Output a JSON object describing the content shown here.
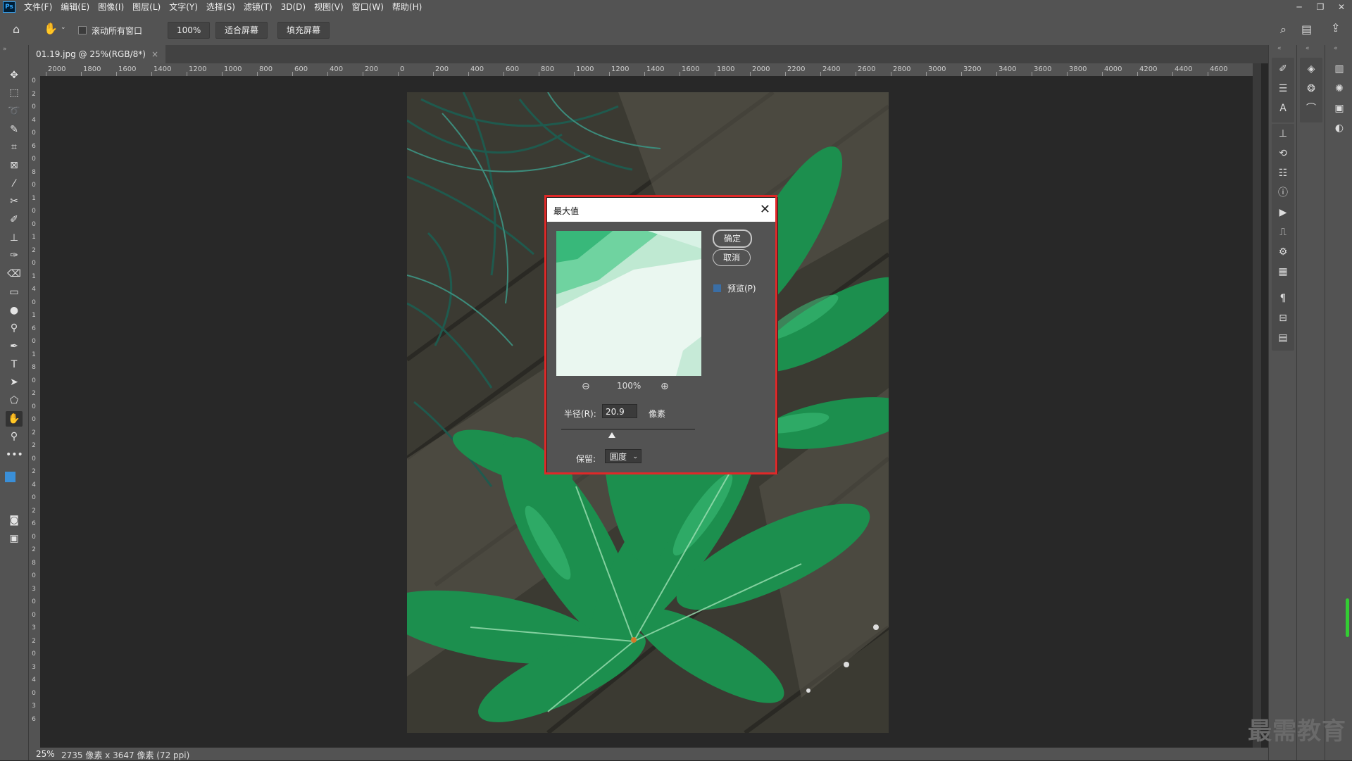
{
  "menubar": {
    "logo": "Ps",
    "items": [
      "文件(F)",
      "编辑(E)",
      "图像(I)",
      "图层(L)",
      "文字(Y)",
      "选择(S)",
      "滤镜(T)",
      "3D(D)",
      "视图(V)",
      "窗口(W)",
      "帮助(H)"
    ],
    "window_controls": [
      "─",
      "❐",
      "✕"
    ]
  },
  "options": {
    "scroll_all_label": "滚动所有窗口",
    "zoom_value": "100%",
    "fit_screen": "适合屏幕",
    "fill_screen": "填充屏幕"
  },
  "document": {
    "tab_title": "01.19.jpg @ 25%(RGB/8*)",
    "close": "×"
  },
  "ruler_top_labels": [
    "2000",
    "1800",
    "1600",
    "1400",
    "1200",
    "1000",
    "800",
    "600",
    "400",
    "200",
    "0",
    "200",
    "400",
    "600",
    "800",
    "1000",
    "1200",
    "1400",
    "1600",
    "1800",
    "2000",
    "2200",
    "2400",
    "2600",
    "2800",
    "3000",
    "3200",
    "3400",
    "3600",
    "3800",
    "4000",
    "4200",
    "4400",
    "4600"
  ],
  "ruler_left_labels": [
    "0",
    "2",
    "0",
    "4",
    "0",
    "6",
    "0",
    "8",
    "0",
    "1",
    "0",
    "0",
    "1",
    "2",
    "0",
    "1",
    "4",
    "0",
    "1",
    "6",
    "0",
    "1",
    "8",
    "0",
    "2",
    "0",
    "0",
    "2",
    "2",
    "0",
    "2",
    "4",
    "0",
    "2",
    "6",
    "0",
    "2",
    "8",
    "0",
    "3",
    "0",
    "0",
    "3",
    "2",
    "0",
    "3",
    "4",
    "0",
    "3",
    "6"
  ],
  "dialog": {
    "title": "最大值",
    "ok": "确定",
    "cancel": "取消",
    "preview_label": "预览(P)",
    "zoom": "100%",
    "radius_label": "半径(R):",
    "radius_value": "20.9",
    "radius_unit": "像素",
    "slider_position": 0.38,
    "preserve_label": "保留:",
    "preserve_value": "圆度"
  },
  "status": {
    "zoom": "25%",
    "info": "2735 像素 x 3647 像素 (72 ppi)"
  },
  "watermark": "最需教育",
  "colors": {
    "foreground": "#3a8fd8",
    "background": "#ffffff",
    "highlight": "#e02828"
  }
}
